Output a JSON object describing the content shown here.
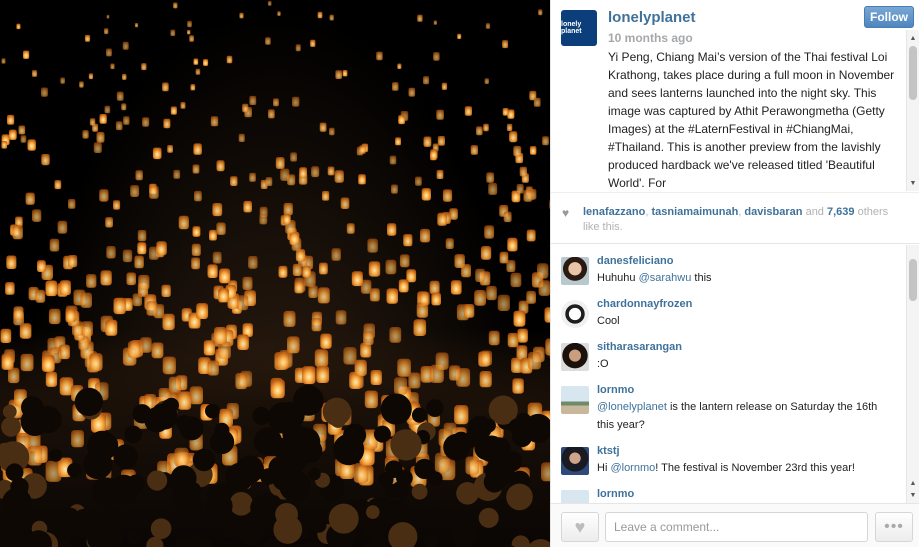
{
  "post": {
    "logo_text": "lonely planet",
    "username": "lonelyplanet",
    "time_ago": "10 months ago",
    "follow_label": "Follow",
    "caption": "Yi Peng, Chiang Mai’s version of the Thai festival Loi Krathong, takes place during a full moon in November and sees lanterns launched into the night sky. This image was captured by Athit Perawongmetha (Getty Images) at the #LaternFestival in #ChiangMai, #Thailand. This is another preview from the lavishly produced hardback we've released titled 'Beautiful World'. For"
  },
  "likes": {
    "user1": "lenafazzano",
    "sep1": ", ",
    "user2": "tasniamaimunah",
    "sep2": ", ",
    "user3": "davisbaran",
    "and_label": " and ",
    "count": "7,639",
    "suffix": " others like this."
  },
  "comments": [
    {
      "user": "danesfeliciano",
      "text": "Huhuhu ",
      "mention": "@sarahwu",
      "text_after": " this"
    },
    {
      "user": "chardonnayfrozen",
      "text": "Cool"
    },
    {
      "user": "sitharasarangan",
      "text": ":O"
    },
    {
      "user": "lornmo",
      "mention": "@lonelyplanet",
      "text_after": " is the lantern release on Saturday the 16th this year?"
    },
    {
      "user": "ktstj",
      "text": "Hi ",
      "mention": "@lornmo",
      "text_after": "! The festival is November 23rd this year!"
    },
    {
      "user": "lornmo"
    }
  ],
  "footer": {
    "comment_placeholder": "Leave a comment...",
    "more_label": "•••"
  },
  "colors": {
    "link": "#3f729b",
    "follow_button": "#4e86bf",
    "lantern": "#ffb14a"
  },
  "icons": {
    "heart": "heart-icon",
    "more": "ellipsis-icon"
  }
}
